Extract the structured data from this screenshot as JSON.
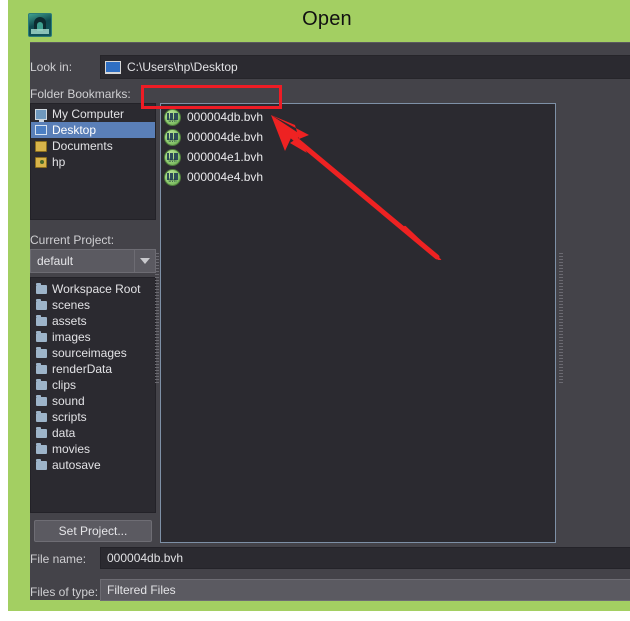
{
  "window": {
    "title": "Open",
    "app_icon": "maya-app-icon",
    "frame_color": "#a3cf62",
    "body_color": "#444349"
  },
  "lookin": {
    "label": "Look in:",
    "path": "C:\\Users\\hp\\Desktop",
    "icon": "desktop-monitor-icon"
  },
  "bookmarks": {
    "label": "Folder Bookmarks:",
    "items": [
      {
        "label": "My Computer",
        "icon": "computer-icon",
        "selected": false
      },
      {
        "label": "Desktop",
        "icon": "desktop-icon",
        "selected": true
      },
      {
        "label": "Documents",
        "icon": "folder-icon",
        "selected": false
      },
      {
        "label": "hp",
        "icon": "user-folder-icon",
        "selected": false
      }
    ]
  },
  "current_project": {
    "label": "Current Project:",
    "value": "default",
    "dropdown_icon": "chevron-down-icon"
  },
  "project_tree": {
    "items": [
      "Workspace Root",
      "scenes",
      "assets",
      "images",
      "sourceimages",
      "renderData",
      "clips",
      "sound",
      "scripts",
      "data",
      "movies",
      "autosave"
    ]
  },
  "set_project": {
    "label": "Set Project..."
  },
  "file_list": {
    "items": [
      {
        "name": "000004db.bvh",
        "icon": "bvh-file-icon",
        "selected": true
      },
      {
        "name": "000004de.bvh",
        "icon": "bvh-file-icon",
        "selected": false
      },
      {
        "name": "000004e1.bvh",
        "icon": "bvh-file-icon",
        "selected": false
      },
      {
        "name": "000004e4.bvh",
        "icon": "bvh-file-icon",
        "selected": false
      }
    ]
  },
  "file_name": {
    "label": "File name:",
    "value": "000004db.bvh"
  },
  "files_of_type": {
    "label": "Files of type:",
    "value": "Filtered Files"
  },
  "annotations": {
    "highlight_color": "#ee1c25",
    "rect_target": "000004db.bvh",
    "arrow": "points-to-selected-file"
  }
}
